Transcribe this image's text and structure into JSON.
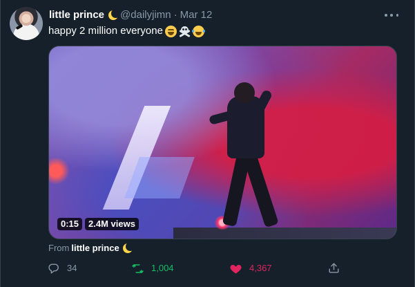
{
  "tweet": {
    "author": {
      "display_name": "little prince",
      "handle": "@dailyjimn",
      "separator": "·",
      "date": "Mar 12"
    },
    "text": "happy 2 million everyone",
    "emojis": [
      "tired-face-emoji",
      "skull-crossbones-emoji",
      "face-with-tears-of-joy-emoji"
    ],
    "media": {
      "duration": "0:15",
      "views": "2.4M views"
    },
    "attribution": {
      "prefix": "From",
      "source_name": "little prince"
    },
    "actions": {
      "reply_count": "34",
      "retweet_count": "1,004",
      "like_count": "4,367"
    },
    "colors": {
      "background": "#15202b",
      "retweet_active": "#17bf63",
      "like_active": "#e0245e",
      "secondary_text": "#8899a6"
    }
  }
}
